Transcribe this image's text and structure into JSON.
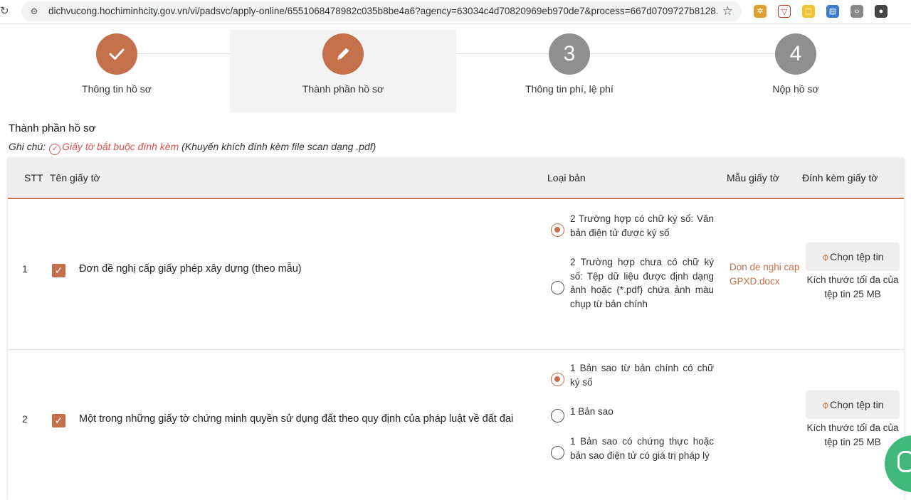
{
  "browser": {
    "url": "dichvucong.hochiminhcity.gov.vn/vi/padsvc/apply-online/6551068478982c035b8be4a6?agency=63034c4d70820969eb970de7&process=667d0709727b8128..."
  },
  "stepper": {
    "steps": [
      {
        "label": "Thông tin hồ sơ",
        "icon": "check-icon"
      },
      {
        "label": "Thành phần hồ sơ",
        "icon": "pencil-icon"
      },
      {
        "label": "Thông tin phí, lệ phí",
        "number": "3"
      },
      {
        "label": "Nộp hồ sơ",
        "number": "4"
      }
    ]
  },
  "section": {
    "title": "Thành phần hồ sơ",
    "note_label": "Ghi chú:",
    "required_text": "Giấy tờ bắt buộc đính kèm",
    "hint": "(Khuyến khích đính kèm file scan dạng .pdf)"
  },
  "table": {
    "headers": {
      "stt": "STT",
      "name": "Tên giấy tờ",
      "type": "Loại bản",
      "template": "Mẫu giấy tờ",
      "attach": "Đính kèm giấy tờ"
    },
    "rows": [
      {
        "stt": "1",
        "name": "Đơn đề nghị cấp giấy phép xây dựng (theo mẫu)",
        "options": [
          {
            "text": "2 Trường hợp có chữ ký số: Văn bản điện tử được ký số",
            "selected": true
          },
          {
            "text": "2 Trường hợp chưa có chữ ký số: Tệp dữ liệu được định dạng ảnh hoặc (*.pdf) chứa ảnh màu chụp từ bản chính",
            "selected": false
          }
        ],
        "template": "Don de nghi cap GPXD.docx",
        "button": "Chọn tệp tin",
        "size_note": "Kích thước tối đa của tệp tin 25 MB"
      },
      {
        "stt": "2",
        "name": "Một trong những giấy tờ chứng minh quyền sử dụng đất theo quy định của pháp luật về đất đai",
        "options": [
          {
            "text": "1 Bản sao từ bản chính có chữ ký số",
            "selected": true
          },
          {
            "text": "1 Bản sao",
            "selected": false
          },
          {
            "text": "1 Bản sao có chứng thực hoặc bản sao điện tử có giá trị pháp lý",
            "selected": false
          }
        ],
        "template": "",
        "button": "Chọn tệp tin",
        "size_note": "Kích thước tối đa của tệp tin 25 MB"
      }
    ]
  },
  "colors": {
    "accent": "#c4714b",
    "inactive_step": "#8f8f8f",
    "required": "#d9534f",
    "chat": "#3fb87a"
  }
}
